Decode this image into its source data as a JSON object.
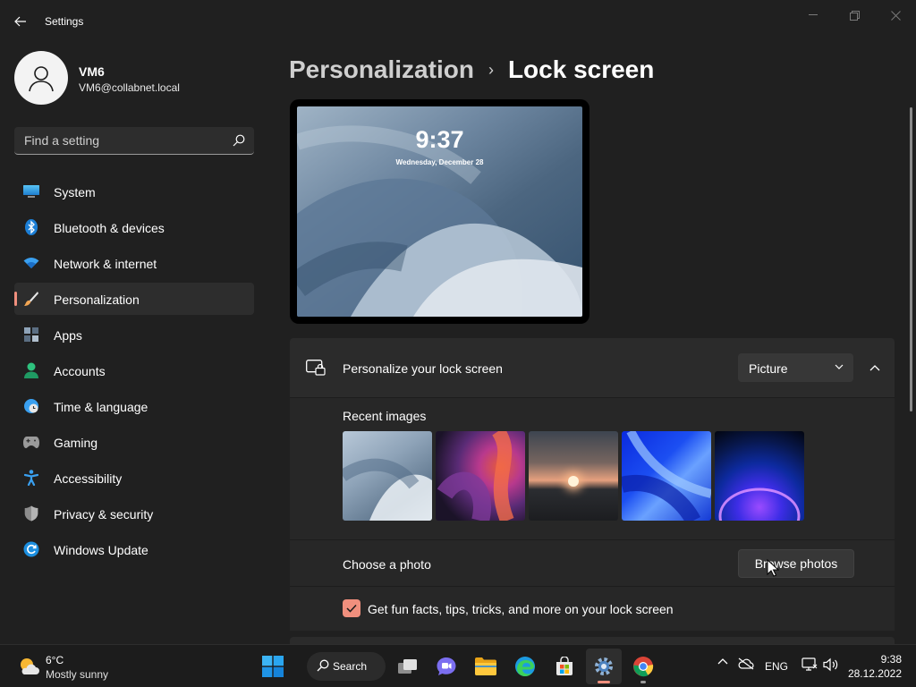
{
  "window": {
    "title": "Settings"
  },
  "profile": {
    "name": "VM6",
    "email": "VM6@collabnet.local"
  },
  "search": {
    "placeholder": "Find a setting"
  },
  "sidebar": {
    "items": [
      {
        "label": "System",
        "icon": "monitor-icon",
        "active": false
      },
      {
        "label": "Bluetooth & devices",
        "icon": "bluetooth-icon",
        "active": false
      },
      {
        "label": "Network & internet",
        "icon": "wifi-icon",
        "active": false
      },
      {
        "label": "Personalization",
        "icon": "brush-icon",
        "active": true
      },
      {
        "label": "Apps",
        "icon": "apps-icon",
        "active": false
      },
      {
        "label": "Accounts",
        "icon": "person-icon",
        "active": false
      },
      {
        "label": "Time & language",
        "icon": "globe-clock-icon",
        "active": false
      },
      {
        "label": "Gaming",
        "icon": "gamepad-icon",
        "active": false
      },
      {
        "label": "Accessibility",
        "icon": "accessibility-icon",
        "active": false
      },
      {
        "label": "Privacy & security",
        "icon": "shield-icon",
        "active": false
      },
      {
        "label": "Windows Update",
        "icon": "update-icon",
        "active": false
      }
    ]
  },
  "breadcrumb": {
    "parent": "Personalization",
    "separator": "›",
    "current": "Lock screen"
  },
  "preview": {
    "time": "9:37",
    "date": "Wednesday, December 28"
  },
  "lock_card": {
    "title": "Personalize your lock screen",
    "dropdown_value": "Picture",
    "recent_label": "Recent images",
    "recent_images": [
      "windows-bloom-grey",
      "abstract-swirl",
      "sunset-lake",
      "windows-bloom-blue",
      "windows-glow-purple"
    ],
    "choose_label": "Choose a photo",
    "browse_button": "Browse photos",
    "fun_facts_label": "Get fun facts, tips, tricks, and more on your lock screen",
    "fun_facts_checked": true
  },
  "taskbar": {
    "weather_temp": "6°C",
    "weather_desc": "Mostly sunny",
    "search_label": "Search",
    "language": "ENG",
    "time": "9:38",
    "date": "28.12.2022"
  },
  "colors": {
    "accent": "#f08f7d",
    "background": "#202020",
    "card": "#2b2b2b"
  }
}
